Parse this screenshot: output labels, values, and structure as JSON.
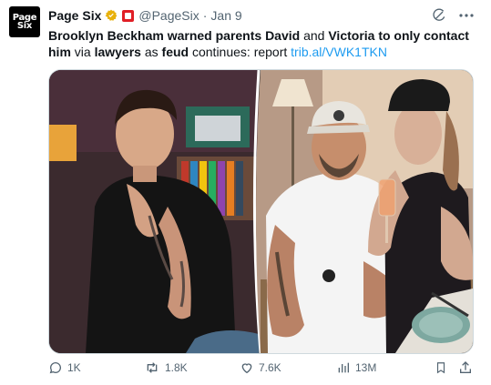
{
  "account": {
    "avatar_line1": "Page",
    "avatar_line2": "Six",
    "name": "Page Six",
    "handle": "@PageSix",
    "separator": "·",
    "date": "Jan 9"
  },
  "tweet": {
    "part1_bold": "Brooklyn Beckham warned parents David",
    "part2": " and ",
    "part3_bold": "Victoria to only contact him",
    "part4": " via ",
    "part5_bold": "lawyers",
    "part6": " as ",
    "part7_bold": "feud",
    "part8": " continues: report ",
    "link": "trib.al/VWK1TKN"
  },
  "stats": {
    "replies": "1K",
    "reposts": "1.8K",
    "likes": "7.6K",
    "views": "13M"
  },
  "colors": {
    "link": "#1d9bf0",
    "muted": "#536471",
    "verified": "#e8b10b",
    "affiliate": "#e01f26"
  }
}
